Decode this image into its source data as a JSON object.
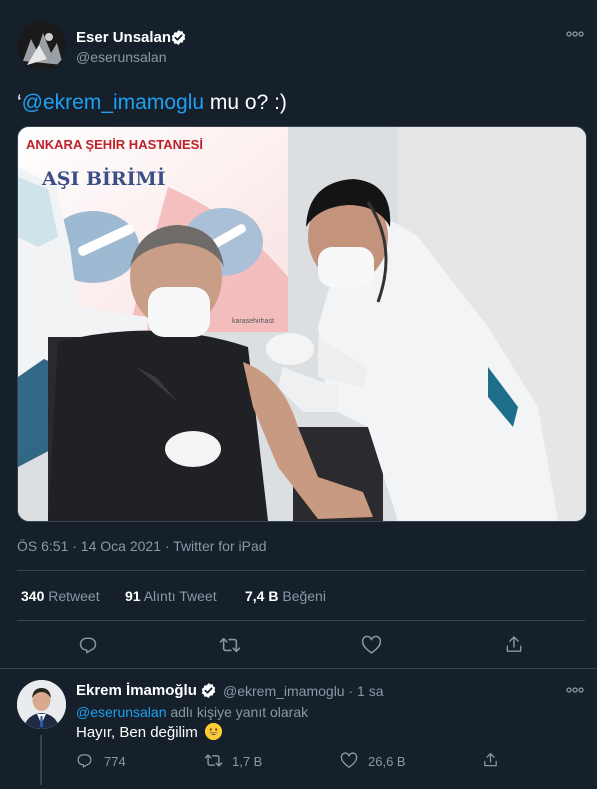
{
  "main_tweet": {
    "author_name": "Eser Unsalan",
    "author_handle": "@eserunsalan",
    "text_prefix": "‘",
    "text_mention": "@ekrem_imamoglu",
    "text_rest": " mu o? :)",
    "photo": {
      "sign_top": "ANKARA ŞEHİR HASTANESİ",
      "sign_main": "AŞI BİRİMİ",
      "sign_small": "karasehirhast"
    },
    "timestamp": "ÖS 6:51 · 14 Oca 2021 · Twitter for iPad",
    "stats": {
      "retweets_count": "340",
      "retweets_label": "Retweet",
      "quotes_count": "91",
      "quotes_label": "Alıntı Tweet",
      "likes_count": "7,4 B",
      "likes_label": "Beğeni"
    }
  },
  "reply": {
    "author_name": "Ekrem İmamoğlu",
    "author_handle": "@ekrem_imamoglu",
    "time": "1 sa",
    "replying_mention": "@eserunsalan",
    "replying_text": " adlı kişiye yanıt olarak",
    "text": "Hayır, Ben değilim",
    "emoji": "😀",
    "reply_count": "774",
    "retweet_count": "1,7 B",
    "like_count": "26,6 B"
  },
  "colors": {
    "background": "#15202b",
    "accent": "#1da1f2",
    "muted": "#8899a6",
    "divider": "#38444d"
  },
  "icons": [
    "verified-badge-icon",
    "more-icon",
    "reply-icon",
    "retweet-icon",
    "like-icon",
    "share-icon"
  ]
}
